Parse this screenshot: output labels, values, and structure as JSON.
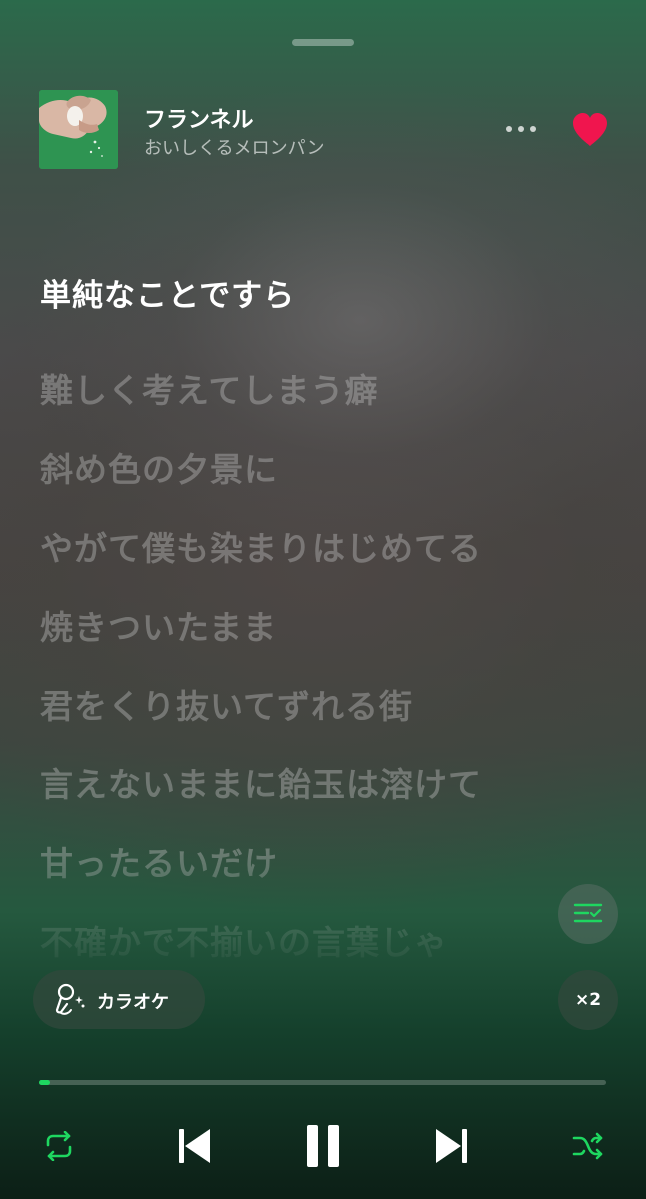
{
  "track": {
    "title": "フランネル",
    "artist": "おいしくるメロンパン",
    "liked": true
  },
  "lyrics": {
    "current_line": "単純なことですら",
    "upcoming_lines": [
      "難しく考えてしまう癖",
      "斜め色の夕景に",
      "やがて僕も染まりはじめてる",
      "焼きついたまま",
      "君をくり抜いてずれる街",
      "言えないままに飴玉は溶けて",
      "甘ったるいだけ",
      "不確かで不揃いの言葉じゃ"
    ]
  },
  "karaoke": {
    "label": "カラオケ"
  },
  "playback": {
    "speed_label": "×2",
    "progress_fraction": 0.02,
    "is_playing": true,
    "repeat_on": true,
    "shuffle_on": true
  },
  "icons": {
    "more": "more-horizontal-icon",
    "like": "heart-icon",
    "queue": "queue-list-icon",
    "karaoke": "microphone-icon",
    "repeat": "repeat-icon",
    "previous": "skip-previous-icon",
    "pause": "pause-icon",
    "next": "skip-next-icon",
    "shuffle": "shuffle-icon"
  },
  "colors": {
    "accent": "#1ed760",
    "heart": "#f0154e"
  }
}
